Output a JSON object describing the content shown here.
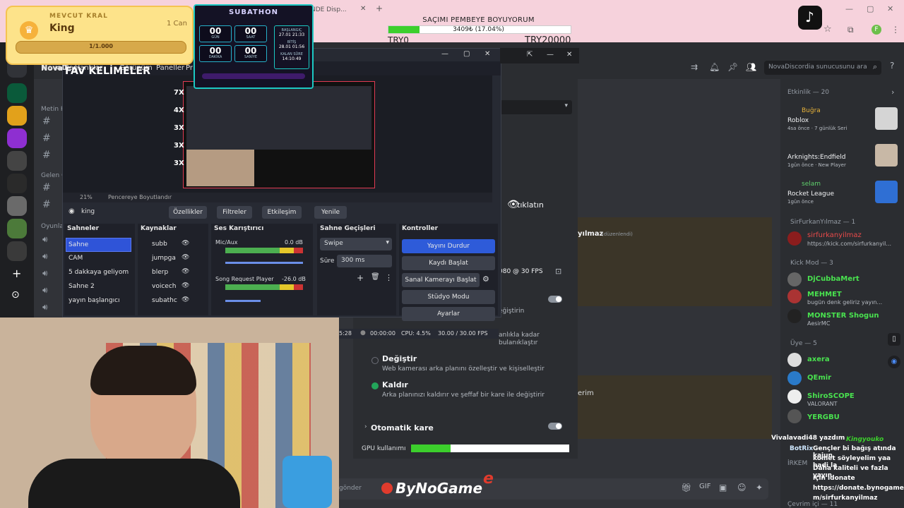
{
  "browser": {
    "tab_title": "NDE Disp..."
  },
  "donation_goal": {
    "title": "SAÇIMI PEMBEYE BOYUYORUM",
    "percent": "3409₺ (17.04%)",
    "progress": 0.1704,
    "min_label": "TRY0",
    "max_label": "TRY20000"
  },
  "king_widget": {
    "label": "MEVCUT KRAL",
    "name": "King",
    "lives": "1 Can",
    "progress": "1/1.000"
  },
  "subathon": {
    "title": "SUBATHON",
    "boxes": [
      {
        "value": "00",
        "label": "GÜN"
      },
      {
        "value": "00",
        "label": "SAAT"
      },
      {
        "value": "00",
        "label": "DAKİKA"
      },
      {
        "value": "00",
        "label": "SANİYE"
      }
    ],
    "start_label": "BAŞLANGIÇ",
    "start": "27.01 21:33",
    "end_label": "BİTİŞ",
    "end": "28.01 01:56",
    "remaining_label": "KALAN SÜRE",
    "remaining": "14:10:49"
  },
  "overlay": {
    "fav_title": "FAV KELİMELER",
    "multipliers": [
      "7X",
      "4X",
      "3X",
      "3X",
      "3X"
    ]
  },
  "obs": {
    "menu": [
      "NovaD",
      "Bağlantılar",
      "Görünüm",
      "Paneller",
      "Pr"
    ],
    "zoom": "21%",
    "resize_label": "Pencereye Boyutlandır",
    "source_name": "king",
    "properties": "Özellikler",
    "filters": "Filtreler",
    "interact": "Etkileşim",
    "refresh": "Yenile",
    "scenes_title": "Sahneler",
    "scenes": [
      "Sahne",
      "CAM",
      "5 dakkaya geliyom",
      "Sahne 2",
      "yayın başlangıcı"
    ],
    "sources_title": "Kaynaklar",
    "sources": [
      "subb",
      "jumpga",
      "blerp",
      "voicech",
      "subathc"
    ],
    "mixer_title": "Ses Karıştırıcı",
    "mixer": [
      {
        "name": "Mic/Aux",
        "db": "0.0 dB"
      },
      {
        "name": "Song Request Player",
        "db": "-26.0 dB"
      }
    ],
    "transitions_title": "Sahne Geçişleri",
    "transition": "Swipe",
    "duration_label": "Süre",
    "duration": "300 ms",
    "controls_title": "Kontroller",
    "controls": [
      "Yayını Durdur",
      "Kaydı Başlat",
      "Sanal Kamerayı Başlat",
      "Stüdyo Modu",
      "Ayarlar"
    ],
    "status": {
      "time_live": "5:28",
      "time_rec": "00:00:00",
      "cpu": "CPU: 4.5%",
      "fps": "30.00 / 30.00 FPS"
    }
  },
  "discord": {
    "server_name": "NovaD",
    "search_placeholder": "NovaDiscordia sunucusunu ara",
    "channel_cats": [
      "Metin K",
      "Gelen G",
      "Oyunlar"
    ],
    "settings": {
      "click_hint": "tıklatın",
      "resolution": "080 @ 30 FPS",
      "blur_hint": "anlıkla kadar bulanıklaştır",
      "change_title": "Değiştir",
      "change_sub": "Web kamerası arka planını özelleştir ve kişiselleştir",
      "remove_title": "Kaldır",
      "remove_sub": "Arka planınızı kaldırır ve şeffaf bir kare ile değiştirir",
      "auto_frame": "Otomatik kare",
      "gpu_label": "GPU kullanımı",
      "gpu_usage": 0.25,
      "edited": "(düzenlendi)",
      "partial_name": "yılmaz",
      "partial_text": "erim",
      "degistirin": "eğiştirin"
    },
    "members": {
      "activity_header": "Etkinlik — 20",
      "activity": [
        {
          "name": "Buğra",
          "game": "Roblox",
          "sub": "4sa önce · 7 günlük Seri"
        },
        {
          "name": "",
          "game": "Arknights:Endfield",
          "sub": "1gün önce · New Player"
        },
        {
          "name": "selam",
          "game": "Rocket League",
          "sub": "1gün önce"
        }
      ],
      "sir_header": "SirFurkanYılmaz — 1",
      "sir_name": "sirfurkanyilmaz",
      "sir_sub": "https://kick.com/sirfurkanyil...",
      "kick_header": "Kick Mod — 3",
      "kick": [
        {
          "name": "DjCubbaMert",
          "sub": ""
        },
        {
          "name": "MEHMET",
          "sub": "bugün denk geliriz yayın..."
        },
        {
          "name": "MONSTER Shogun",
          "sub": "AesirMC"
        }
      ],
      "member_header": "Üye — 5",
      "member": [
        {
          "name": "axera",
          "sub": ""
        },
        {
          "name": "QEmir",
          "sub": ""
        },
        {
          "name": "ShiroSCOPE",
          "sub": "VALORANT"
        },
        {
          "name": "YERGBU",
          "sub": ""
        }
      ],
      "irkem": "İRKEM",
      "online_header": "Çevrim içi — 11"
    },
    "send_placeholder": "gönder"
  },
  "chat_overlay": {
    "lines": [
      "Vivalavadi48 yazdım",
      "Kingyouko",
      "BotRix",
      "Gençler bi bağış atında kajun",
      "komet söyleyelim yaa hadi la",
      "Daha kaliteli ve fazla yayın",
      "için idonate",
      "https://donate.bynogame.co",
      "m/sirfurkanyilmaz"
    ]
  },
  "bynogame_logo": "ByNoGame",
  "colors": {
    "obs_accent": "#2e5bd9",
    "discord_bg": "#313338",
    "goal_fill": "#3ccf2c",
    "king_bg": "#fde38a"
  }
}
